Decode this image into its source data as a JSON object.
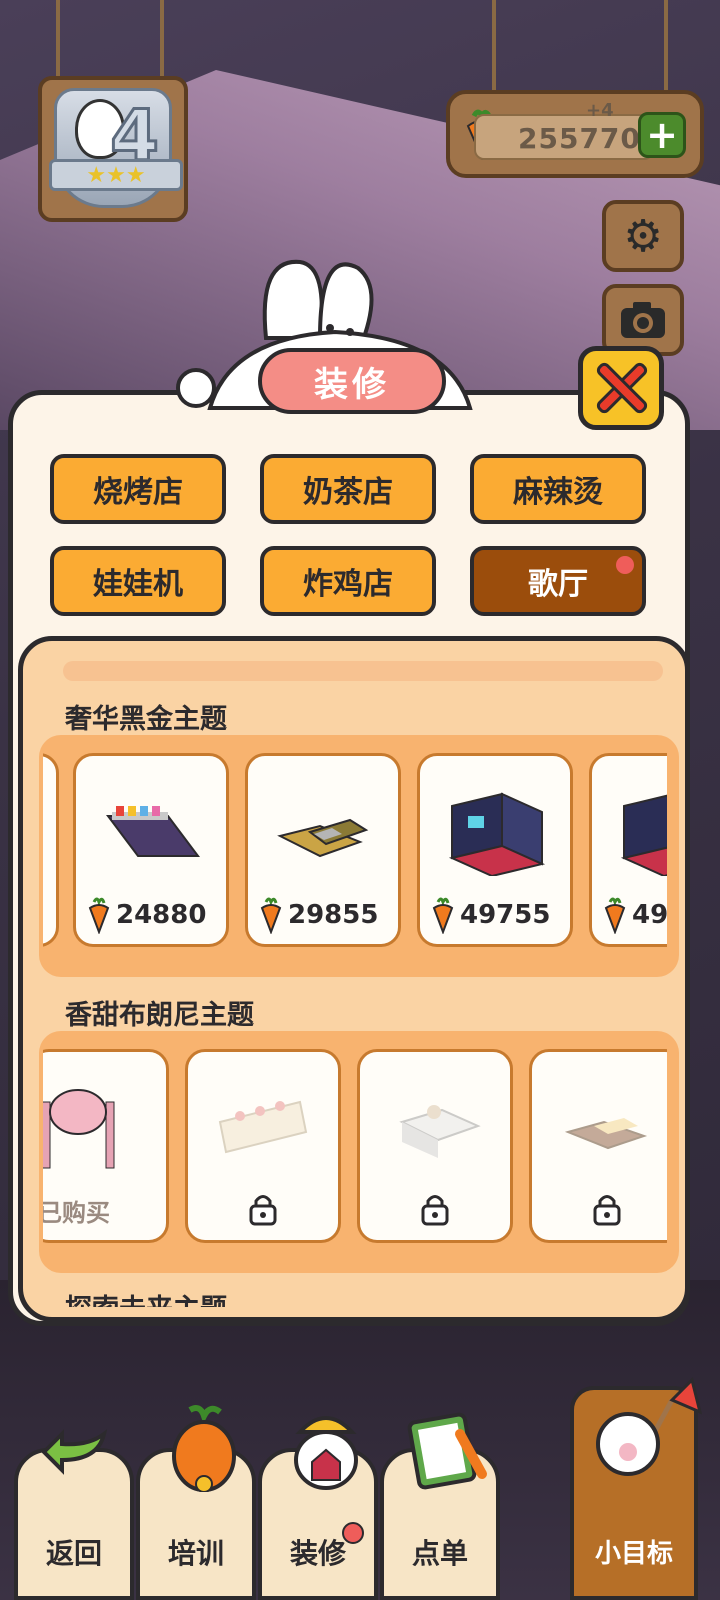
{
  "hud": {
    "level": "4",
    "level_stars": "★★★",
    "currency_value": "255770",
    "currency_delta": "+4",
    "add_label": "+"
  },
  "panel": {
    "title": "装修",
    "categories": [
      {
        "label": "烧烤店",
        "active": false
      },
      {
        "label": "奶茶店",
        "active": false
      },
      {
        "label": "麻辣烫",
        "active": false
      },
      {
        "label": "娃娃机",
        "active": false
      },
      {
        "label": "炸鸡店",
        "active": false
      },
      {
        "label": "歌厅",
        "active": true
      }
    ],
    "sections": [
      {
        "title": "奢华黑金主题",
        "items": [
          {
            "price": "24880"
          },
          {
            "price": "29855"
          },
          {
            "price": "49755"
          },
          {
            "price": "49"
          }
        ]
      },
      {
        "title": "香甜布朗尼主题",
        "items": [
          {
            "status": "已购买"
          },
          {
            "status": "locked"
          },
          {
            "status": "locked"
          },
          {
            "status": "locked"
          }
        ]
      },
      {
        "title": "探索未来主题"
      }
    ]
  },
  "nav": {
    "back": "返回",
    "train": "培训",
    "decorate": "装修",
    "order": "点单",
    "goal": "小目标"
  },
  "colors": {
    "accent_orange": "#fbab33",
    "active_brown": "#9b4d0c",
    "title_pink": "#f48d86",
    "close_yellow": "#f7c227"
  }
}
